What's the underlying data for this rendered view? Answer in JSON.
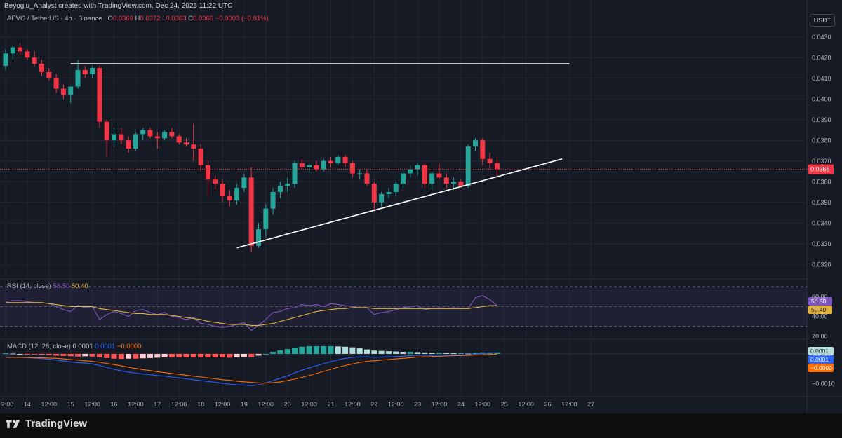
{
  "header": {
    "credit": "Beyoglu_Analyst created with TradingView.com, Dec 24, 2025 11:22 UTC",
    "symbol_line": "AEVO / TetherUS · 4h · Binance",
    "o_label": "O",
    "o_value": "0.0369",
    "h_label": "H",
    "h_value": "0.0372",
    "l_label": "L",
    "l_value": "0.0363",
    "c_label": "C",
    "c_value": "0.0366",
    "change": "−0.0003 (−0.81%)",
    "currency_button": "USDT"
  },
  "colors": {
    "background": "#161a25",
    "grid": "#22262f",
    "bull": "#26a69a",
    "bear": "#f23645",
    "rsi_line": "#7e57c2",
    "rsi_ma": "#e3b341",
    "macd_line": "#2962ff",
    "signal_line": "#ff6d00",
    "trendline": "#ffffff"
  },
  "chart_data": [
    {
      "type": "candlestick",
      "title": "AEVO / TetherUS · 4h · Binance",
      "ylim": [
        0.0315,
        0.0435
      ],
      "y_ticks": [
        "0.0430",
        "0.0420",
        "0.0410",
        "0.0400",
        "0.0390",
        "0.0380",
        "0.0370",
        "0.0360",
        "0.0350",
        "0.0340",
        "0.0330",
        "0.0320"
      ],
      "last_price": "0.0366",
      "x_start": "Dec 13 12:00",
      "x_step_hours": 4,
      "candles": [
        [
          0.0416,
          0.0424,
          0.0414,
          0.0422
        ],
        [
          0.0422,
          0.0426,
          0.0419,
          0.0425
        ],
        [
          0.0425,
          0.0427,
          0.0421,
          0.0423
        ],
        [
          0.0423,
          0.0424,
          0.0419,
          0.042
        ],
        [
          0.042,
          0.0423,
          0.0416,
          0.0417
        ],
        [
          0.0417,
          0.0419,
          0.0411,
          0.0413
        ],
        [
          0.0413,
          0.0415,
          0.0409,
          0.041
        ],
        [
          0.041,
          0.0412,
          0.0403,
          0.0405
        ],
        [
          0.0405,
          0.0407,
          0.04,
          0.0402
        ],
        [
          0.0402,
          0.0406,
          0.0398,
          0.0406
        ],
        [
          0.0406,
          0.0419,
          0.0405,
          0.0414
        ],
        [
          0.0414,
          0.0416,
          0.041,
          0.0412
        ],
        [
          0.0412,
          0.0416,
          0.041,
          0.0415
        ],
        [
          0.0415,
          0.0416,
          0.0386,
          0.0389
        ],
        [
          0.0389,
          0.039,
          0.0372,
          0.038
        ],
        [
          0.038,
          0.0386,
          0.0377,
          0.0383
        ],
        [
          0.0383,
          0.0386,
          0.0378,
          0.038
        ],
        [
          0.038,
          0.0382,
          0.0374,
          0.0376
        ],
        [
          0.0376,
          0.0384,
          0.0375,
          0.0383
        ],
        [
          0.0383,
          0.0386,
          0.038,
          0.0385
        ],
        [
          0.0385,
          0.0386,
          0.0381,
          0.0382
        ],
        [
          0.0382,
          0.0384,
          0.0376,
          0.0381
        ],
        [
          0.0381,
          0.0385,
          0.038,
          0.0384
        ],
        [
          0.0384,
          0.0386,
          0.0381,
          0.0382
        ],
        [
          0.0382,
          0.0383,
          0.0378,
          0.0379
        ],
        [
          0.0379,
          0.0381,
          0.0377,
          0.0378
        ],
        [
          0.0378,
          0.0388,
          0.037,
          0.0376
        ],
        [
          0.0376,
          0.0378,
          0.0365,
          0.0368
        ],
        [
          0.0368,
          0.037,
          0.0353,
          0.0361
        ],
        [
          0.0361,
          0.0363,
          0.0356,
          0.0359
        ],
        [
          0.0359,
          0.0361,
          0.035,
          0.0353
        ],
        [
          0.0353,
          0.0356,
          0.0348,
          0.0351
        ],
        [
          0.0351,
          0.0359,
          0.0349,
          0.0357
        ],
        [
          0.0357,
          0.0364,
          0.0355,
          0.0362
        ],
        [
          0.0362,
          0.0367,
          0.0326,
          0.0329
        ],
        [
          0.0329,
          0.034,
          0.0328,
          0.0337
        ],
        [
          0.0337,
          0.0349,
          0.0333,
          0.0347
        ],
        [
          0.0347,
          0.0357,
          0.0344,
          0.0355
        ],
        [
          0.0355,
          0.036,
          0.0352,
          0.0358
        ],
        [
          0.0358,
          0.0362,
          0.0355,
          0.0359
        ],
        [
          0.0359,
          0.037,
          0.0357,
          0.0369
        ],
        [
          0.0369,
          0.0371,
          0.0366,
          0.0367
        ],
        [
          0.0367,
          0.0369,
          0.0364,
          0.0368
        ],
        [
          0.0368,
          0.037,
          0.0365,
          0.0366
        ],
        [
          0.0366,
          0.0371,
          0.0365,
          0.037
        ],
        [
          0.037,
          0.0372,
          0.0367,
          0.0369
        ],
        [
          0.0369,
          0.0373,
          0.0368,
          0.0372
        ],
        [
          0.0372,
          0.0373,
          0.0367,
          0.0369
        ],
        [
          0.0369,
          0.037,
          0.0362,
          0.0364
        ],
        [
          0.0364,
          0.0366,
          0.0361,
          0.0364
        ],
        [
          0.0364,
          0.0366,
          0.0358,
          0.0359
        ],
        [
          0.0359,
          0.036,
          0.0346,
          0.035
        ],
        [
          0.035,
          0.0355,
          0.0348,
          0.0354
        ],
        [
          0.0354,
          0.0357,
          0.0352,
          0.0355
        ],
        [
          0.0355,
          0.036,
          0.0353,
          0.0359
        ],
        [
          0.0359,
          0.0366,
          0.0357,
          0.0364
        ],
        [
          0.0364,
          0.0368,
          0.0362,
          0.0366
        ],
        [
          0.0366,
          0.0369,
          0.0363,
          0.0368
        ],
        [
          0.0368,
          0.0369,
          0.0357,
          0.0359
        ],
        [
          0.0359,
          0.0365,
          0.0356,
          0.0364
        ],
        [
          0.0364,
          0.0369,
          0.0361,
          0.0362
        ],
        [
          0.0362,
          0.0364,
          0.0357,
          0.0359
        ],
        [
          0.0359,
          0.0362,
          0.0356,
          0.036
        ],
        [
          0.036,
          0.0361,
          0.0357,
          0.0358
        ],
        [
          0.0358,
          0.0378,
          0.0357,
          0.0377
        ],
        [
          0.0377,
          0.0381,
          0.0375,
          0.038
        ],
        [
          0.038,
          0.0381,
          0.0368,
          0.0371
        ],
        [
          0.0371,
          0.0374,
          0.0366,
          0.0369
        ],
        [
          0.0369,
          0.0372,
          0.0363,
          0.0366
        ]
      ],
      "trendlines": [
        {
          "name": "resistance",
          "from": {
            "x": "Dec 15 00:00",
            "y": 0.0417
          },
          "to": {
            "x": "Dec 26 12:00",
            "y": 0.0417
          }
        },
        {
          "name": "rising support",
          "from": {
            "x": "Dec 18 20:00",
            "y": 0.0328
          },
          "to": {
            "x": "Dec 26 08:00",
            "y": 0.0371
          }
        }
      ]
    },
    {
      "type": "line",
      "title": "RSI (14, close)",
      "legend_values": [
        "58.50",
        "50.40"
      ],
      "ylim": [
        20,
        75
      ],
      "y_ticks": [
        "60.00",
        "40.00",
        "20.00"
      ],
      "band": [
        30,
        70
      ],
      "series": [
        {
          "name": "RSI",
          "last_label": "50.50",
          "values": [
            55,
            56,
            56,
            55,
            54,
            54,
            53,
            50,
            47,
            45,
            51,
            49,
            50,
            37,
            42,
            45,
            43,
            40,
            46,
            47,
            44,
            42,
            44,
            40,
            39,
            37,
            39,
            33,
            32,
            30,
            29,
            30,
            32,
            34,
            26,
            31,
            37,
            44,
            45,
            48,
            49,
            52,
            51,
            52,
            50,
            53,
            52,
            51,
            50,
            49,
            49,
            42,
            44,
            45,
            47,
            49,
            50,
            51,
            47,
            48,
            49,
            48,
            49,
            48,
            48,
            59,
            61,
            57,
            51
          ]
        },
        {
          "name": "RSI MA",
          "last_label": "50.40",
          "values": [
            54,
            54,
            54,
            54,
            54,
            54,
            53,
            52,
            51,
            50,
            50,
            50,
            50,
            48,
            47,
            46,
            45,
            44,
            43,
            43,
            42,
            42,
            42,
            41,
            40,
            39,
            38,
            37,
            35,
            34,
            33,
            32,
            32,
            32,
            31,
            31,
            32,
            33,
            35,
            37,
            39,
            41,
            43,
            45,
            46,
            47,
            48,
            48,
            49,
            49,
            49,
            48,
            48,
            48,
            48,
            48,
            48,
            48,
            48,
            48,
            48,
            48,
            48,
            48,
            48,
            49,
            50,
            51,
            51
          ]
        }
      ]
    },
    {
      "type": "bar",
      "title": "MACD (12, 26, close)",
      "legend_values": [
        "0.0001",
        "0.0001",
        "−0.0000"
      ],
      "ylim": [
        -0.0013,
        0.0004
      ],
      "y_ticks": [
        "0.0000",
        "−0.0010"
      ],
      "series": [
        {
          "name": "MACD",
          "last_label": "0.0001",
          "values": [
            -0.0001,
            -0.00011,
            -0.00012,
            -0.00013,
            -0.00014,
            -0.00016,
            -0.00018,
            -0.00021,
            -0.00024,
            -0.00027,
            -0.0003,
            -0.00031,
            -0.00034,
            -0.00039,
            -0.00046,
            -0.00052,
            -0.00057,
            -0.00061,
            -0.00065,
            -0.00068,
            -0.0007,
            -0.00073,
            -0.00075,
            -0.00078,
            -0.00081,
            -0.00084,
            -0.00087,
            -0.0009,
            -0.00093,
            -0.00096,
            -0.00099,
            -0.00102,
            -0.00104,
            -0.00105,
            -0.00107,
            -0.00104,
            -0.00098,
            -0.0009,
            -0.00082,
            -0.00074,
            -0.00064,
            -0.00055,
            -0.00047,
            -0.0004,
            -0.00033,
            -0.00026,
            -0.0002,
            -0.00015,
            -0.00012,
            -0.0001,
            -0.0001,
            -0.00012,
            -0.00011,
            -0.0001,
            -9e-05,
            -8e-05,
            -6e-05,
            -5e-05,
            -5e-05,
            -5e-05,
            -4e-05,
            -4e-05,
            -4e-05,
            -4e-05,
            -4e-05,
            -1e-05,
            2e-05,
            3e-05,
            4e-05
          ]
        },
        {
          "name": "Signal",
          "last_label": "−0.0000",
          "values": [
            -0.00012,
            -0.00012,
            -0.00012,
            -0.00012,
            -0.00013,
            -0.00013,
            -0.00014,
            -0.00015,
            -0.00017,
            -0.00019,
            -0.00021,
            -0.00023,
            -0.00025,
            -0.00028,
            -0.00032,
            -0.00036,
            -0.0004,
            -0.00045,
            -0.00049,
            -0.00053,
            -0.00056,
            -0.0006,
            -0.00063,
            -0.00066,
            -0.00069,
            -0.00072,
            -0.00075,
            -0.00078,
            -0.00081,
            -0.00084,
            -0.00087,
            -0.00089,
            -0.00092,
            -0.00094,
            -0.00096,
            -0.00098,
            -0.00098,
            -0.00097,
            -0.00094,
            -0.0009,
            -0.00085,
            -0.00079,
            -0.00073,
            -0.00066,
            -0.00059,
            -0.00052,
            -0.00045,
            -0.00039,
            -0.00034,
            -0.00029,
            -0.00025,
            -0.00023,
            -0.00021,
            -0.00019,
            -0.00017,
            -0.00015,
            -0.00013,
            -0.00011,
            -0.0001,
            -9e-05,
            -8e-05,
            -7e-05,
            -6e-05,
            -6e-05,
            -5e-05,
            -4e-05,
            -3e-05,
            -2e-05,
            -1e-05
          ]
        },
        {
          "name": "Histogram",
          "last_label": "0.0001",
          "values": [
            2e-05,
            1e-05,
            0.0,
            -1e-05,
            -1e-05,
            -3e-05,
            -4e-05,
            -6e-05,
            -7e-05,
            -8e-05,
            -9e-05,
            -8e-05,
            -9e-05,
            -0.00011,
            -0.00014,
            -0.00016,
            -0.00017,
            -0.00016,
            -0.00016,
            -0.00015,
            -0.00014,
            -0.00013,
            -0.00012,
            -0.00012,
            -0.00012,
            -0.00012,
            -0.00012,
            -0.00012,
            -0.00012,
            -0.00012,
            -0.00012,
            -0.00013,
            -0.00012,
            -0.00011,
            -0.00011,
            -6e-05,
            0.0,
            7e-05,
            0.00012,
            0.00016,
            0.00021,
            0.00024,
            0.00026,
            0.00026,
            0.00026,
            0.00026,
            0.00025,
            0.00024,
            0.00022,
            0.00019,
            0.00015,
            0.00011,
            0.0001,
            9e-05,
            8e-05,
            7e-05,
            7e-05,
            6e-05,
            5e-05,
            4e-05,
            4e-05,
            3e-05,
            2e-05,
            2e-05,
            1e-05,
            3e-05,
            5e-05,
            5e-05,
            5e-05
          ]
        }
      ]
    }
  ],
  "x_axis_labels": [
    "12:00",
    "14",
    "12:00",
    "15",
    "12:00",
    "16",
    "12:00",
    "17",
    "12:00",
    "18",
    "12:00",
    "19",
    "12:00",
    "20",
    "12:00",
    "21",
    "12:00",
    "22",
    "12:00",
    "23",
    "12:00",
    "24",
    "12:00",
    "25",
    "12:00",
    "26",
    "12:00",
    "27"
  ],
  "footer": {
    "brand": "TradingView"
  }
}
